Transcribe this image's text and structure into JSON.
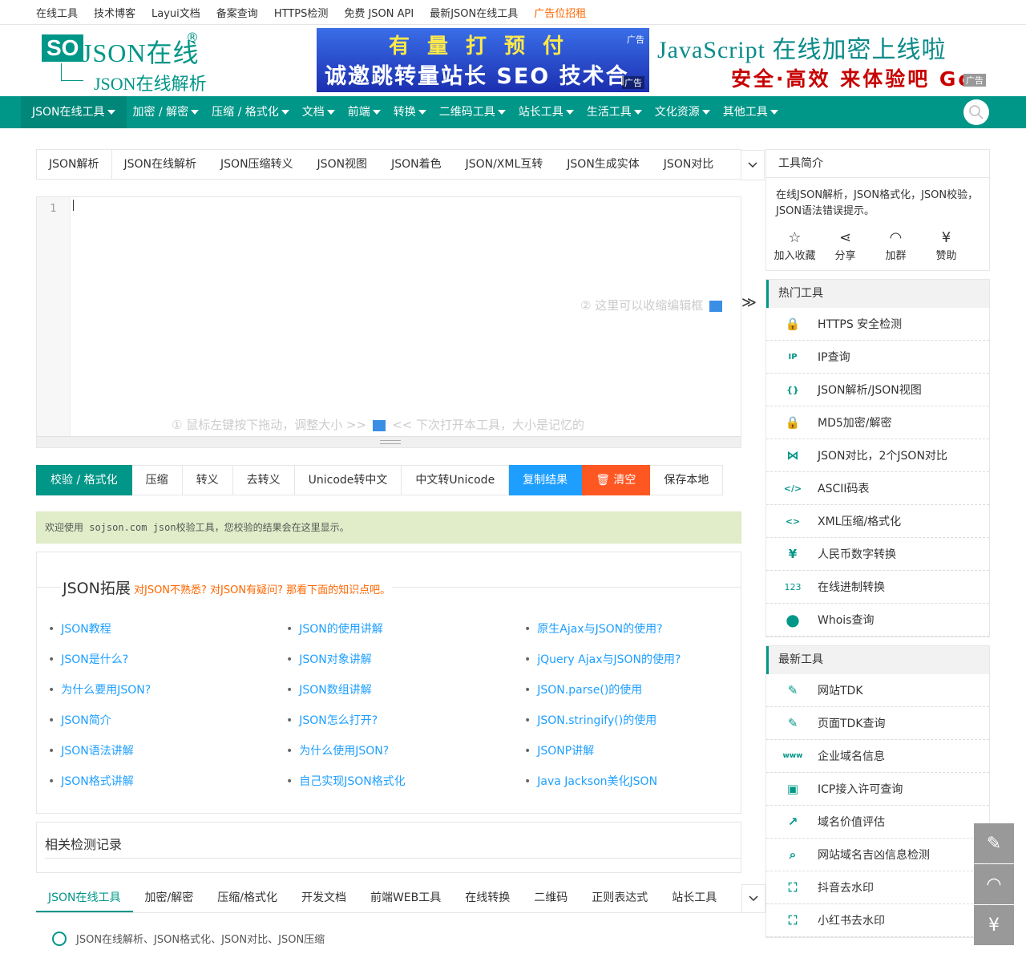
{
  "topbar": [
    "在线工具",
    "技术博客",
    "Layui文档",
    "备案查询",
    "HTTPS检测",
    "免费 JSON API",
    "最新JSON在线工具",
    "广告位招租"
  ],
  "logo": {
    "so": "SO",
    "json": "JSON在线",
    "reg": "®",
    "sub": "JSON在线解析"
  },
  "banner1": {
    "line1": "有量打预付",
    "line2": "诚邀跳转量站长 SEO 技术合作",
    "tag": "广告",
    "tag2": "广告"
  },
  "banner2": {
    "line1": "JavaScript 在线加密上线啦",
    "line2": "安全·高效 来体验吧 Go",
    "tag": "广告"
  },
  "nav": [
    "JSON在线工具",
    "加密 / 解密",
    "压缩 / 格式化",
    "文档",
    "前端",
    "转换",
    "二维码工具",
    "站长工具",
    "生活工具",
    "文化资源",
    "其他工具"
  ],
  "tabs": [
    "JSON解析",
    "JSON在线解析",
    "JSON压缩转义",
    "JSON视图",
    "JSON着色",
    "JSON/XML互转",
    "JSON生成实体",
    "JSON对比"
  ],
  "editor": {
    "line": "1",
    "hint1": "② 这里可以收缩编辑框",
    "hint2a": "① 鼠标左键按下拖动，调整大小 >>",
    "hint2b": "<< 下次打开本工具，大小是记忆的",
    "collapse": "≫"
  },
  "actions": [
    "校验 / 格式化",
    "压缩",
    "转义",
    "去转义",
    "Unicode转中文",
    "中文转Unicode",
    "复制结果",
    "🗑 清空",
    "保存本地"
  ],
  "result": "欢迎使用 sojson.com json校验工具，您校验的结果会在这里显示。",
  "ext": {
    "title": "JSON拓展",
    "subtitle": "对JSON不熟悉? 对JSON有疑问? 那看下面的知识点吧。",
    "links": [
      "JSON教程",
      "JSON的使用讲解",
      "原生Ajax与JSON的使用?",
      "JSON是什么?",
      "JSON对象讲解",
      "jQuery Ajax与JSON的使用?",
      "为什么要用JSON?",
      "JSON数组讲解",
      "JSON.parse()的使用",
      "JSON简介",
      "JSON怎么打开?",
      "JSON.stringify()的使用",
      "JSON语法讲解",
      "为什么使用JSON?",
      "JSONP讲解",
      "JSON格式讲解",
      "自己实现JSON格式化",
      "Java Jackson美化JSON"
    ]
  },
  "record": "相关检测记录",
  "btabs": [
    "JSON在线工具",
    "加密/解密",
    "压缩/格式化",
    "开发文档",
    "前端WEB工具",
    "在线转换",
    "二维码",
    "正则表达式",
    "站长工具"
  ],
  "bitem": "JSON在线解析、JSON格式化、JSON对比、JSON压缩",
  "intro": {
    "title": "工具简介",
    "text": "在线JSON解析，JSON格式化，JSON校验，JSON语法错误提示。",
    "icons": [
      {
        "icon": "☆",
        "label": "加入收藏"
      },
      {
        "icon": "⋖",
        "label": "分享"
      },
      {
        "icon": "◠",
        "label": "加群"
      },
      {
        "icon": "¥",
        "label": "赞助"
      }
    ]
  },
  "hot": {
    "title": "热门工具",
    "items": [
      {
        "icon": "🔒",
        "label": "HTTPS 安全检测"
      },
      {
        "icon": "IP",
        "label": "IP查询"
      },
      {
        "icon": "{}",
        "label": "JSON解析/JSON视图"
      },
      {
        "icon": "🔒",
        "label": "MD5加密/解密"
      },
      {
        "icon": "⋈",
        "label": "JSON对比，2个JSON对比"
      },
      {
        "icon": "</>",
        "label": "ASCII码表"
      },
      {
        "icon": "<>",
        "label": "XML压缩/格式化"
      },
      {
        "icon": "¥",
        "label": "人民币数字转换"
      },
      {
        "icon": "123",
        "label": "在线进制转换"
      },
      {
        "icon": "●",
        "label": "Whois查询"
      }
    ]
  },
  "newest": {
    "title": "最新工具",
    "items": [
      {
        "icon": "✎",
        "label": "网站TDK"
      },
      {
        "icon": "✎",
        "label": "页面TDK查询"
      },
      {
        "icon": "www",
        "label": "企业域名信息"
      },
      {
        "icon": "▣",
        "label": "ICP接入许可查询"
      },
      {
        "icon": "↗",
        "label": "域名价值评估"
      },
      {
        "icon": "⌕",
        "label": "网站域名吉凶信息检测"
      },
      {
        "icon": "⛶",
        "label": "抖音去水印"
      },
      {
        "icon": "⛶",
        "label": "小红书去水印"
      }
    ]
  },
  "float": [
    "✎",
    "◠",
    "¥"
  ]
}
